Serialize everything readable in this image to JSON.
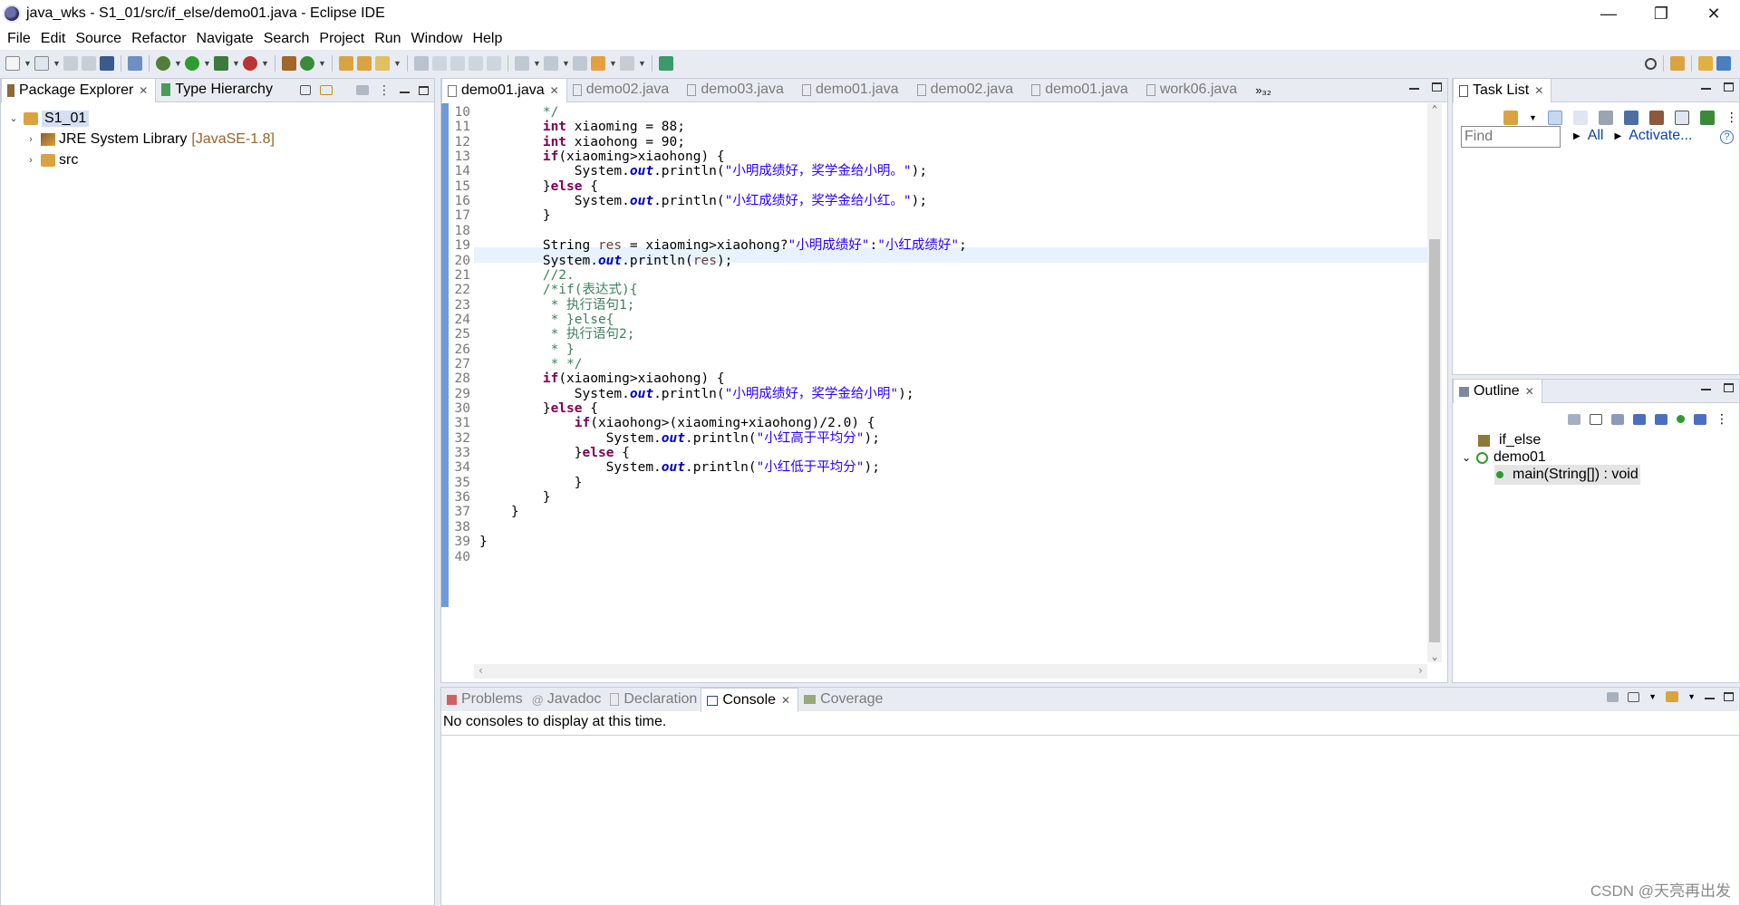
{
  "window": {
    "title": "java_wks - S1_01/src/if_else/demo01.java - Eclipse IDE",
    "controls": [
      "—",
      "❐",
      "✕"
    ]
  },
  "menu": [
    "File",
    "Edit",
    "Source",
    "Refactor",
    "Navigate",
    "Search",
    "Project",
    "Run",
    "Window",
    "Help"
  ],
  "package_explorer": {
    "tabs": [
      {
        "label": "Package Explorer",
        "active": true
      },
      {
        "label": "Type Hierarchy",
        "active": false
      }
    ],
    "tree": {
      "project": "S1_01",
      "children": [
        {
          "label": "JRE System Library",
          "decoration": "[JavaSE-1.8]"
        },
        {
          "label": "src",
          "decoration": ""
        }
      ]
    }
  },
  "editor": {
    "tabs": [
      "demo01.java",
      "demo02.java",
      "demo03.java",
      "demo01.java",
      "demo02.java",
      "demo01.java",
      "work06.java"
    ],
    "active_tab_index": 0,
    "overflow_label": "»₃₂",
    "current_line": 18
  },
  "task_list": {
    "tab": "Task List",
    "find_placeholder": "Find",
    "all_label": "All",
    "activate_label": "Activate..."
  },
  "outline": {
    "tab": "Outline",
    "items": [
      {
        "label": "if_else",
        "kind": "package"
      },
      {
        "label": "demo01",
        "kind": "class"
      },
      {
        "label": "main(String[]) : void",
        "kind": "method"
      }
    ]
  },
  "bottom_panel": {
    "tabs": [
      {
        "label": "Problems",
        "active": false
      },
      {
        "label": "Javadoc",
        "active": false
      },
      {
        "label": "Declaration",
        "active": false
      },
      {
        "label": "Console",
        "active": true
      },
      {
        "label": "Coverage",
        "active": false
      }
    ],
    "message": "No consoles to display at this time."
  },
  "watermark": "CSDN @天亮再出发",
  "colors": {
    "keyword": "#7f0055",
    "string": "#2a00ff",
    "comment": "#3f7f5f",
    "field": "#0000c0",
    "local_variable": "#6a3e3e",
    "chrome": "#e8ecf2"
  }
}
